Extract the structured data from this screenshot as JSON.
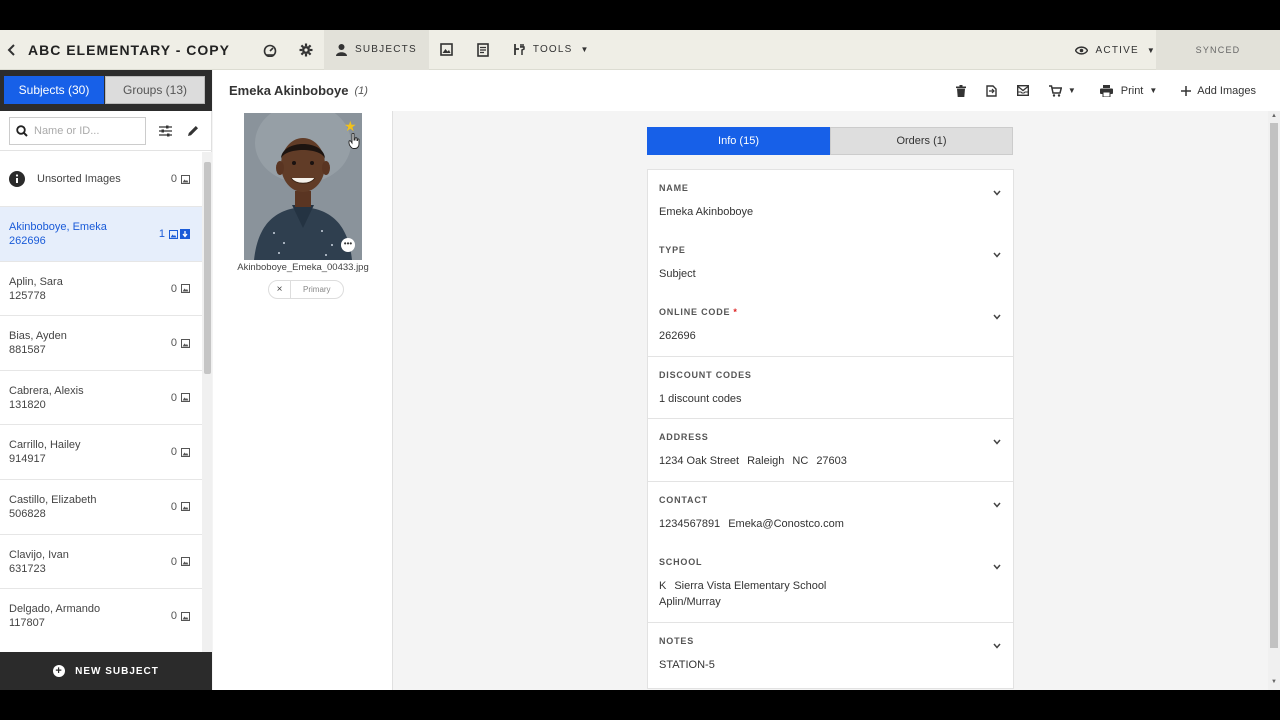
{
  "topbar": {
    "project_title": "ABC ELEMENTARY - COPY",
    "tab_subjects": "SUBJECTS",
    "tab_tools": "TOOLS",
    "status": "ACTIVE",
    "sync": "SYNCED"
  },
  "sidebar": {
    "tab_subjects": "Subjects (30)",
    "tab_groups": "Groups (13)",
    "search_placeholder": "Name or ID...",
    "unsorted": {
      "label": "Unsorted Images",
      "count": "0"
    },
    "items": [
      {
        "name": "Akinboboye, Emeka",
        "code": "262696",
        "count": "1",
        "selected": true
      },
      {
        "name": "Aplin, Sara",
        "code": "125778",
        "count": "0"
      },
      {
        "name": "Bias, Ayden",
        "code": "881587",
        "count": "0"
      },
      {
        "name": "Cabrera, Alexis",
        "code": "131820",
        "count": "0"
      },
      {
        "name": "Carrillo, Hailey",
        "code": "914917",
        "count": "0"
      },
      {
        "name": "Castillo, Elizabeth",
        "code": "506828",
        "count": "0"
      },
      {
        "name": "Clavijo, Ivan",
        "code": "631723",
        "count": "0"
      },
      {
        "name": "Delgado, Armando",
        "code": "117807",
        "count": "0"
      }
    ],
    "new_subject": "NEW SUBJECT"
  },
  "header": {
    "subject_name": "Emeka Akinboboye",
    "image_count": "(1)",
    "print_label": "Print",
    "add_images_label": "Add Images"
  },
  "image_panel": {
    "filename": "Akinboboye_Emeka_00433.jpg",
    "primary_label": "Primary",
    "remove_label": "×"
  },
  "details": {
    "tab_info": "Info (15)",
    "tab_orders": "Orders (1)",
    "name_label": "NAME",
    "name_value": "Emeka Akinboboye",
    "type_label": "TYPE",
    "type_value": "Subject",
    "online_code_label": "ONLINE CODE",
    "online_code_required": "*",
    "online_code_value": "262696",
    "discount_label": "DISCOUNT CODES",
    "discount_value": "1 discount codes",
    "address_label": "ADDRESS",
    "address_street": "1234 Oak Street",
    "address_city": "Raleigh",
    "address_state": "NC",
    "address_zip": "27603",
    "contact_label": "CONTACT",
    "contact_phone": "1234567891",
    "contact_email": "Emeka@Conostco.com",
    "school_label": "SCHOOL",
    "school_grade": "K",
    "school_name": "Sierra Vista Elementary School",
    "school_teacher": "Aplin/Murray",
    "notes_label": "NOTES",
    "notes_value": "STATION-5"
  },
  "colors": {
    "accent": "#1760e8",
    "topbar_bg": "#efeee6",
    "sidebar_footer": "#2b2b2b",
    "star": "#f2c11a"
  }
}
